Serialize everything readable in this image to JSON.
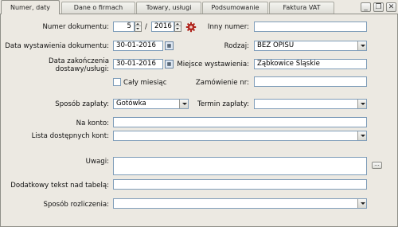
{
  "tabs": [
    {
      "label": "Numer, daty",
      "active": true
    },
    {
      "label": "Dane o firmach",
      "active": false
    },
    {
      "label": "Towary, usługi",
      "active": false
    },
    {
      "label": "Podsumowanie",
      "active": false
    },
    {
      "label": "Faktura VAT",
      "active": false
    }
  ],
  "window_controls": {
    "minimize": "_",
    "restore": "❐",
    "close": "✕"
  },
  "form": {
    "numer_dokumentu_label": "Numer dokumentu:",
    "numer_value": "5",
    "separator": "/",
    "rok_value": "2016",
    "inny_numer_label": "Inny numer:",
    "inny_numer_value": "",
    "data_wystawienia_label": "Data wystawienia dokumentu:",
    "data_wystawienia_value": "30-01-2016",
    "rodzaj_label": "Rodzaj:",
    "rodzaj_value": "BEZ OPISU",
    "data_zakonczenia_label_1": "Data zakończenia",
    "data_zakonczenia_label_2": "dostawy/usługi:",
    "data_zakonczenia_value": "30-01-2016",
    "miejsce_label": "Miejsce wystawienia:",
    "miejsce_value": "Ząbkowice Śląskie",
    "caly_miesiac_label": "Cały miesiąc",
    "caly_miesiac_checked": false,
    "zamowienie_label": "Zamówienie nr:",
    "zamowienie_value": "",
    "sposob_zaplaty_label": "Sposób zapłaty:",
    "sposob_zaplaty_value": "Gotówka",
    "termin_label": "Termin zapłaty:",
    "termin_value": "",
    "na_konto_label": "Na konto:",
    "na_konto_value": "",
    "lista_kont_label": "Lista dostępnych kont:",
    "lista_kont_value": "",
    "uwagi_label": "Uwagi:",
    "uwagi_value": "",
    "dodatkowy_label": "Dodatkowy tekst nad tabelą:",
    "dodatkowy_value": "",
    "sposob_rozliczenia_label": "Sposób rozliczenia:",
    "sposob_rozliczenia_value": ""
  },
  "icons": {
    "calendar": "calendar-icon",
    "generate": "gear-icon",
    "more": "ellipsis-icon"
  },
  "colors": {
    "window_bg": "#ece9e2",
    "field_border": "#7f9db9",
    "generate_icon": "#b0241c"
  }
}
